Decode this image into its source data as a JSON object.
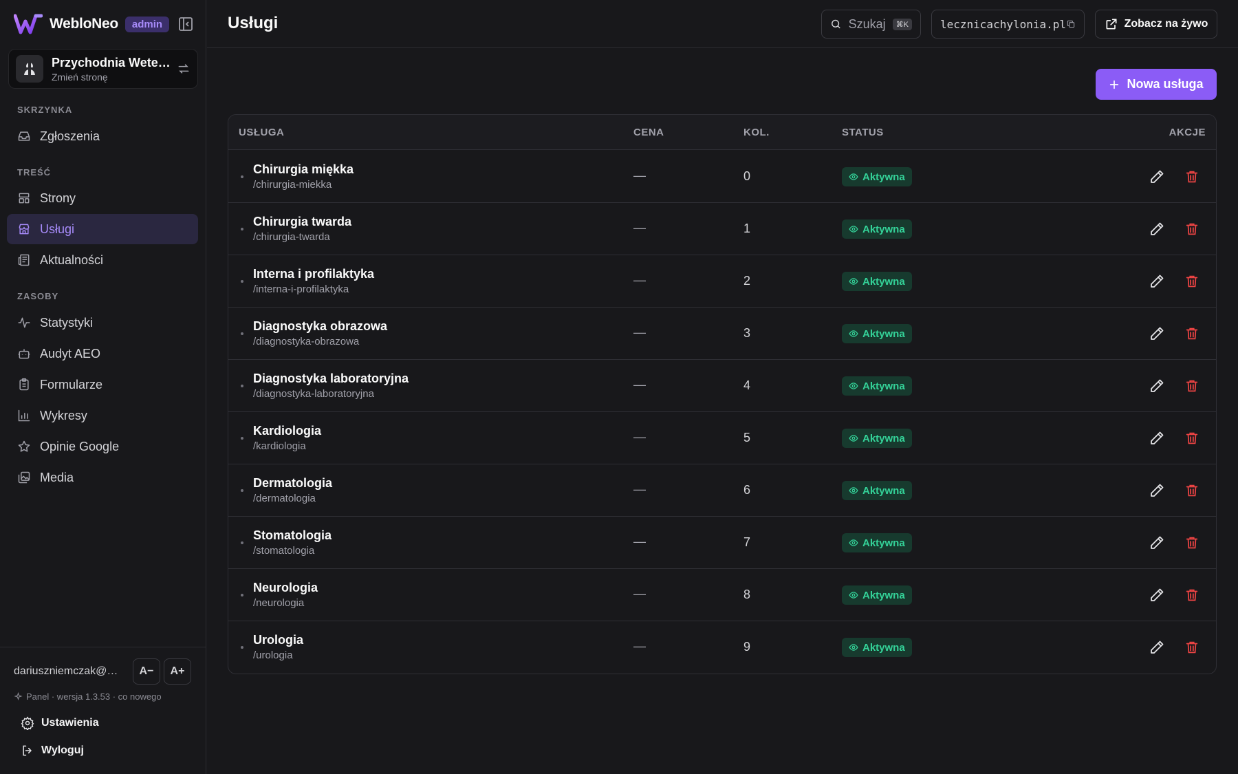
{
  "brand": {
    "name": "WebloNeo",
    "role": "admin"
  },
  "site": {
    "name": "Przychodnia Weterynaryjna",
    "switch_label": "Zmień stronę"
  },
  "nav": {
    "section_inbox": "SKRZYNKA",
    "inbox": "Zgłoszenia",
    "section_content": "TREŚĆ",
    "pages": "Strony",
    "services": "Usługi",
    "news": "Aktualności",
    "section_resources": "ZASOBY",
    "stats": "Statystyki",
    "audit": "Audyt AEO",
    "forms": "Formularze",
    "charts": "Wykresy",
    "reviews": "Opinie Google",
    "media": "Media"
  },
  "footer": {
    "email": "dariuszniemczak@gmail.com",
    "font_decrease": "A−",
    "font_increase": "A+",
    "version": "Panel · wersja 1.3.53 · co nowego",
    "settings": "Ustawienia",
    "logout": "Wyloguj"
  },
  "topbar": {
    "title": "Usługi",
    "search_label": "Szukaj",
    "search_shortcut": "⌘K",
    "domain": "lecznicachylonia.pl",
    "live_label": "Zobacz na żywo"
  },
  "new_button": "Nowa usługa",
  "table": {
    "headers": {
      "service": "USŁUGA",
      "price": "CENA",
      "order": "KOL.",
      "status": "STATUS",
      "actions": "AKCJE"
    },
    "rows": [
      {
        "name": "Chirurgia miękka",
        "slug": "/chirurgia-miekka",
        "price": "—",
        "order": "0",
        "status": "Aktywna"
      },
      {
        "name": "Chirurgia twarda",
        "slug": "/chirurgia-twarda",
        "price": "—",
        "order": "1",
        "status": "Aktywna"
      },
      {
        "name": "Interna i profilaktyka",
        "slug": "/interna-i-profilaktyka",
        "price": "—",
        "order": "2",
        "status": "Aktywna"
      },
      {
        "name": "Diagnostyka obrazowa",
        "slug": "/diagnostyka-obrazowa",
        "price": "—",
        "order": "3",
        "status": "Aktywna"
      },
      {
        "name": "Diagnostyka laboratoryjna",
        "slug": "/diagnostyka-laboratoryjna",
        "price": "—",
        "order": "4",
        "status": "Aktywna"
      },
      {
        "name": "Kardiologia",
        "slug": "/kardiologia",
        "price": "—",
        "order": "5",
        "status": "Aktywna"
      },
      {
        "name": "Dermatologia",
        "slug": "/dermatologia",
        "price": "—",
        "order": "6",
        "status": "Aktywna"
      },
      {
        "name": "Stomatologia",
        "slug": "/stomatologia",
        "price": "—",
        "order": "7",
        "status": "Aktywna"
      },
      {
        "name": "Neurologia",
        "slug": "/neurologia",
        "price": "—",
        "order": "8",
        "status": "Aktywna"
      },
      {
        "name": "Urologia",
        "slug": "/urologia",
        "price": "—",
        "order": "9",
        "status": "Aktywna"
      }
    ]
  },
  "colors": {
    "accent": "#8b5cf6",
    "active_status": "#34d399",
    "danger": "#ef4444",
    "background": "#18181b"
  }
}
